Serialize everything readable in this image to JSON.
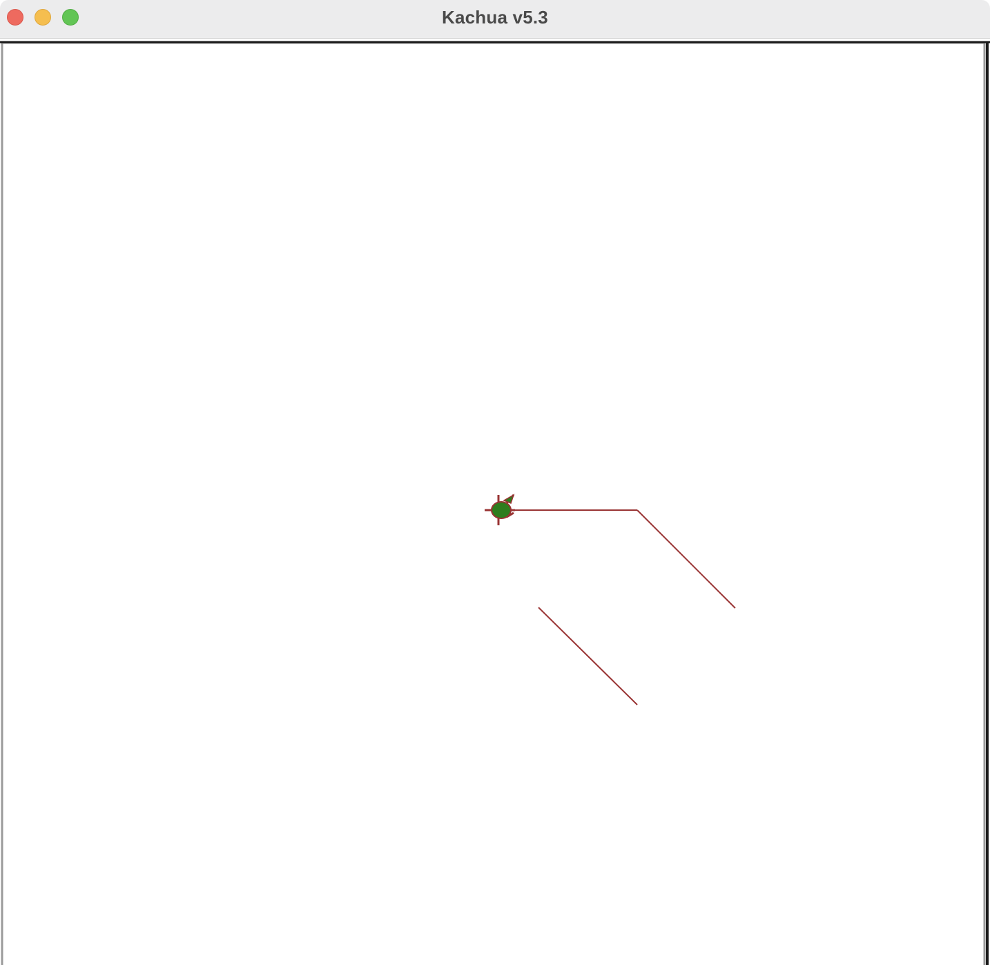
{
  "window": {
    "title": "Kachua v5.3"
  },
  "controls": {
    "close": "close-button",
    "minimize": "minimize-button",
    "zoom": "zoom-button"
  },
  "canvas": {
    "background": "#ffffff",
    "pen_color": "#993333",
    "turtle_fill": "#2e7d1e",
    "turtle_outline": "#993333",
    "turtle_heading_deg": 180,
    "pen_width": 2
  },
  "icons": {
    "turtle": "turtle-icon"
  }
}
